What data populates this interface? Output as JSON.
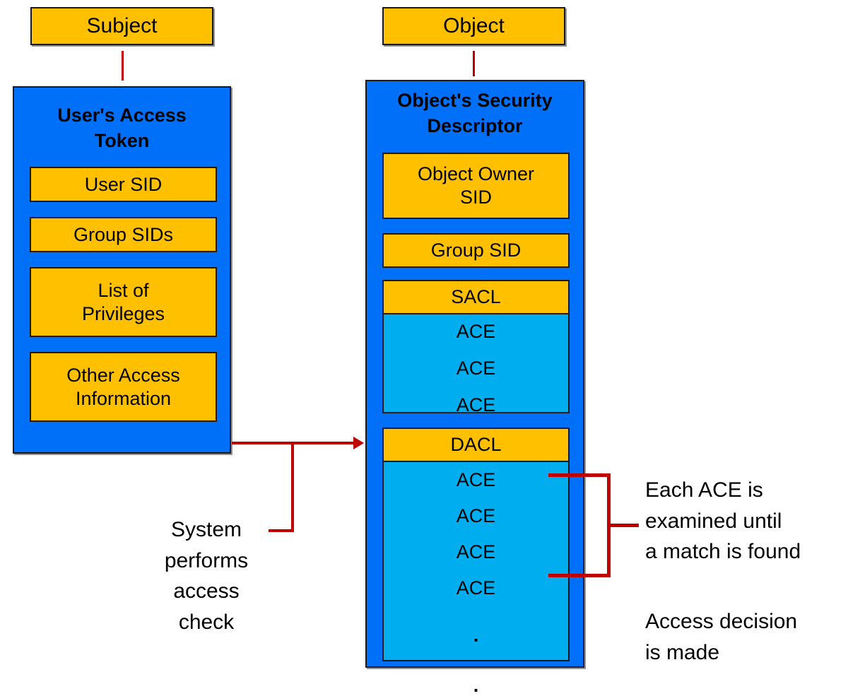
{
  "diagram": {
    "title": "Windows access control check diagram",
    "colors": {
      "yellow": "#FFC000",
      "blue": "#0070F8",
      "cyan": "#00AEEF",
      "connector_red": "#C00000",
      "outline": "#1A1A1A",
      "background": "#FFFFFF"
    }
  },
  "subject": {
    "label": "Subject",
    "token": {
      "title_line1": "User's Access",
      "title_line2": "Token",
      "items": [
        {
          "label": "User SID"
        },
        {
          "label": "Group SIDs"
        },
        {
          "label": "List of\nPrivileges",
          "line1": "List of",
          "line2": "Privileges"
        },
        {
          "label": "Other Access\nInformation",
          "line1": "Other Access",
          "line2": "Information"
        }
      ]
    }
  },
  "object": {
    "label": "Object",
    "descriptor": {
      "title_line1": "Object's Security",
      "title_line2": "Descriptor",
      "owner": {
        "line1": "Object Owner",
        "line2": "SID"
      },
      "group": {
        "label": "Group SID"
      },
      "sacl": {
        "header": "SACL",
        "aces": [
          "ACE",
          "ACE",
          "ACE"
        ]
      },
      "dacl": {
        "header": "DACL",
        "aces": [
          "ACE",
          "ACE",
          "ACE",
          "ACE"
        ],
        "ellipsis": [
          ".",
          "."
        ]
      }
    }
  },
  "annotations": {
    "access_check": {
      "line1": "System",
      "line2": "performs",
      "line3": "access check"
    },
    "each_ace": {
      "line1": "Each ACE is",
      "line2": "examined until",
      "line3": "a match is found"
    },
    "decision": {
      "line1": "Access decision",
      "line2": "is made"
    }
  }
}
